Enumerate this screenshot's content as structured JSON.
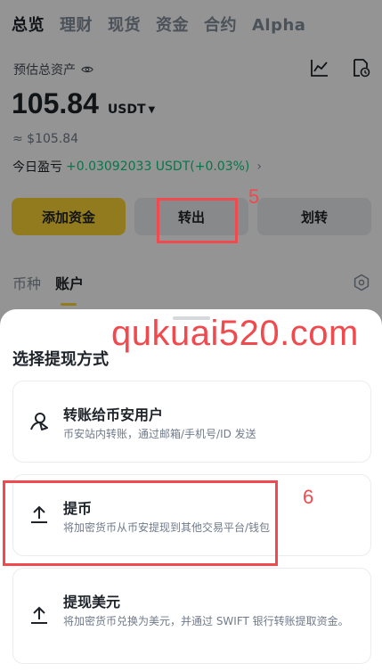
{
  "top_tabs": [
    "总览",
    "理财",
    "现货",
    "资金",
    "合约",
    "Alpha"
  ],
  "estimated_label": "预估总资产",
  "balance": "105.84",
  "unit": "USDT",
  "approx_value": "≈ $105.84",
  "pnl_label": "今日盈亏",
  "pnl_value": "+0.03092033 USDT(+0.03%)",
  "actions": {
    "add": "添加资金",
    "withdraw": "转出",
    "transfer": "划转"
  },
  "sub_tabs": [
    "币种",
    "账户"
  ],
  "sheet": {
    "title": "选择提现方式",
    "options": [
      {
        "title": "转账给币安用户",
        "desc": "币安站内转账，通过邮箱/手机号/ID 发送",
        "icon": "send-to-user-icon"
      },
      {
        "title": "提币",
        "desc": "将加密货币从币安提现到其他交易平台/钱包",
        "icon": "upload-icon"
      },
      {
        "title": "提现美元",
        "desc": "将加密货币兑换为美元，并通过 SWIFT 银行转账提取资金。",
        "icon": "upload-icon"
      }
    ]
  },
  "annotations": {
    "step_5": "5",
    "step_6": "6"
  },
  "watermark": "qukuai520.com",
  "colors": {
    "brand_yellow": "#fcd535",
    "positive": "#0ecb81",
    "annotation_red": "#f0494e"
  }
}
